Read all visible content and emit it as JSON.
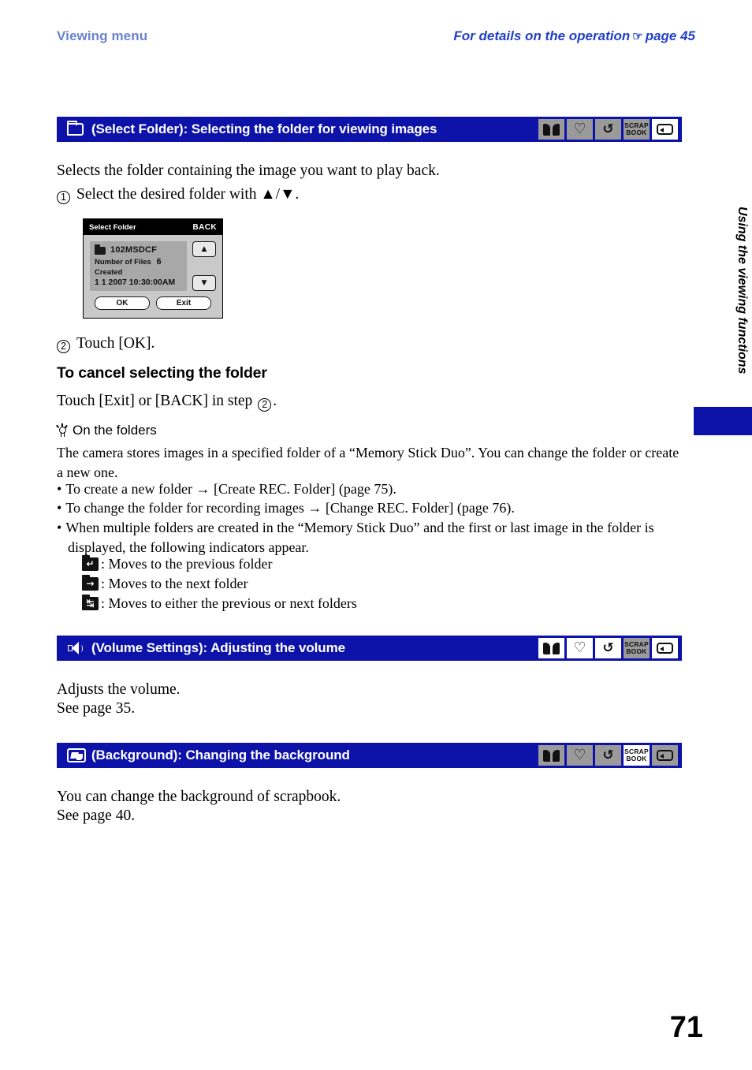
{
  "runhead": {
    "left": "Viewing menu",
    "right_pre": "For details on the operation",
    "right_post": "page 45",
    "pointer": "☞"
  },
  "sections": [
    {
      "icon": "folder-icon",
      "title": "(Select Folder): Selecting the folder for viewing images",
      "badges": [
        {
          "name": "book-icon",
          "label": "",
          "active": false
        },
        {
          "name": "heart-icon",
          "label": "♡",
          "active": false
        },
        {
          "name": "rotate-icon",
          "label": "↺",
          "active": false
        },
        {
          "name": "scrapbook-icon",
          "label": "SCRAP BOOK",
          "active": false
        },
        {
          "name": "screen-icon",
          "label": "",
          "active": true
        }
      ]
    },
    {
      "icon": "speaker-icon",
      "title": "(Volume Settings): Adjusting the volume",
      "badges": [
        {
          "name": "book-icon",
          "label": "",
          "active": true
        },
        {
          "name": "heart-icon",
          "label": "♡",
          "active": true
        },
        {
          "name": "rotate-icon",
          "label": "↺",
          "active": true
        },
        {
          "name": "scrapbook-icon",
          "label": "SCRAP BOOK",
          "active": false
        },
        {
          "name": "screen-icon",
          "label": "",
          "active": true
        }
      ]
    },
    {
      "icon": "background-icon",
      "title": "(Background): Changing the background",
      "badges": [
        {
          "name": "book-icon",
          "label": "",
          "active": false
        },
        {
          "name": "heart-icon",
          "label": "♡",
          "active": false
        },
        {
          "name": "rotate-icon",
          "label": "↺",
          "active": false
        },
        {
          "name": "scrapbook-icon",
          "label": "SCRAP BOOK",
          "active": true
        },
        {
          "name": "screen-icon",
          "label": "",
          "active": false
        }
      ]
    }
  ],
  "select_folder": {
    "intro": "Selects the folder containing the image you want to play back.",
    "step1_num": "1",
    "step1_text": "Select the desired folder with ▲/▼.",
    "step2_num": "2",
    "step2_text": "Touch [OK].",
    "cancel_head": "To cancel selecting the folder",
    "cancel_text_pre": "Touch [Exit] or [BACK] in step",
    "cancel_step_num": "2",
    "cancel_text_post": "."
  },
  "camera_screen": {
    "title": "Select Folder",
    "back_label": "BACK",
    "folder_name": "102MSDCF",
    "files_label": "Number of Files",
    "files_value": "6",
    "created_label": "Created",
    "created_value": "1  1  2007  10:30:00AM",
    "up_arrow": "▲",
    "down_arrow": "▼",
    "ok_label": "OK",
    "exit_label": "Exit"
  },
  "tip": {
    "heading": "On the folders",
    "paragraph": "The camera stores images in a specified folder of a “Memory Stick Duo”. You can change the folder or create a new one.",
    "bullets": [
      "To create a new folder → [Create REC. Folder] (page 75).",
      "To change the folder for recording images → [Change REC. Folder] (page 76).",
      "When multiple folders are created in the “Memory Stick Duo” and the first or last image in the folder is displayed, the following indicators appear."
    ],
    "indicators": [
      {
        "icon": "folder-previous-icon",
        "glyph": "↵",
        "text": ": Moves to the previous folder"
      },
      {
        "icon": "folder-next-icon",
        "glyph": "→",
        "text": ": Moves to the next folder"
      },
      {
        "icon": "folder-either-icon",
        "glyph": "↹",
        "text": ": Moves to either the previous or next folders"
      }
    ]
  },
  "volume": {
    "line1": "Adjusts the volume.",
    "line2": "See page 35."
  },
  "background": {
    "line1": "You can change the background of scrapbook.",
    "line2": "See page 40."
  },
  "side_tab": {
    "label": "Using the viewing functions"
  },
  "page_number": "71",
  "colors": {
    "bar_blue": "#0d12a8",
    "head_blue": "#6a83cf",
    "accent_blue": "#2240c8"
  }
}
